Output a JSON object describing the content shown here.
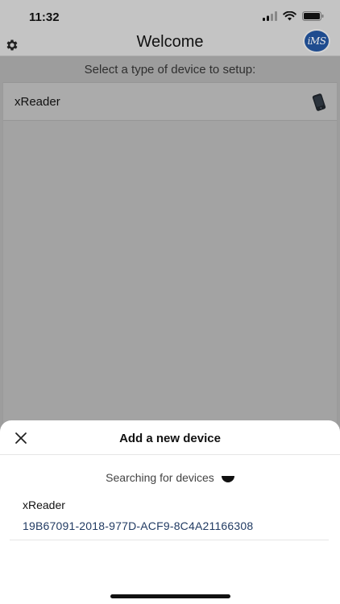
{
  "status_bar": {
    "time": "11:32",
    "icons": [
      "signal-icon",
      "wifi-icon",
      "battery-icon"
    ]
  },
  "nav": {
    "title": "Welcome",
    "settings_icon": "gear-icon",
    "avatar_text": "iMS"
  },
  "main": {
    "subtitle": "Select a type of device to setup:",
    "device_types": [
      {
        "label": "xReader",
        "icon": "card-reader-icon"
      }
    ]
  },
  "sheet": {
    "title": "Add a new device",
    "close_icon": "close-icon",
    "searching_text": "Searching for devices",
    "found_devices": [
      {
        "name": "xReader",
        "id": "19B67091-2018-977D-ACF9-8C4A21166308"
      }
    ]
  },
  "colors": {
    "overlay": "#9d9d9d",
    "sheet": "#ffffff",
    "id_text": "#213b63",
    "avatar": "#1f4c8f"
  }
}
